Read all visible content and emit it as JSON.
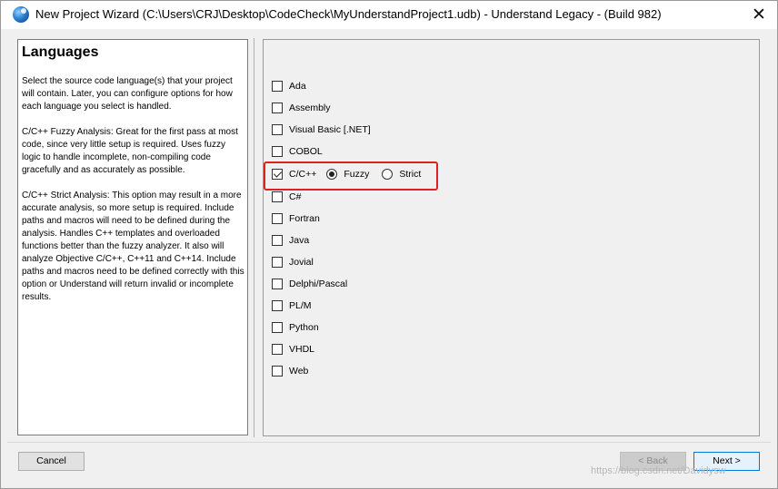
{
  "window": {
    "title": "New Project Wizard (C:\\Users\\CRJ\\Desktop\\CodeCheck\\MyUnderstandProject1.udb) - Understand Legacy - (Build 982)",
    "close_glyph": "✕"
  },
  "left": {
    "heading": "Languages",
    "paragraphs": [
      "Select the source code language(s) that your project will contain. Later, you can configure options for how each language you select is handled.",
      "C/C++ Fuzzy Analysis: Great for the first pass at most code, since very little setup is required. Uses fuzzy logic to handle incomplete, non-compiling code gracefully and as accurately as possible.",
      "C/C++ Strict Analysis: This option may result in a more accurate analysis, so more setup is required. Include paths and macros will need to be defined during the analysis. Handles C++ templates and overloaded functions better than the fuzzy analyzer. It also will analyze Objective C/C++, C++11 and C++14. Include paths and macros need to be defined correctly with this option or Understand will return invalid or incomplete results."
    ]
  },
  "languages": [
    {
      "label": "Ada",
      "checked": false
    },
    {
      "label": "Assembly",
      "checked": false
    },
    {
      "label": "Visual Basic [.NET]",
      "checked": false
    },
    {
      "label": "COBOL",
      "checked": false
    },
    {
      "label": "C/C++",
      "checked": true
    },
    {
      "label": "C#",
      "checked": false
    },
    {
      "label": "Fortran",
      "checked": false
    },
    {
      "label": "Java",
      "checked": false
    },
    {
      "label": "Jovial",
      "checked": false
    },
    {
      "label": "Delphi/Pascal",
      "checked": false
    },
    {
      "label": "PL/M",
      "checked": false
    },
    {
      "label": "Python",
      "checked": false
    },
    {
      "label": "VHDL",
      "checked": false
    },
    {
      "label": "Web",
      "checked": false
    }
  ],
  "cpp_mode": {
    "fuzzy_label": "Fuzzy",
    "strict_label": "Strict",
    "selected": "Fuzzy"
  },
  "buttons": {
    "cancel": "Cancel",
    "back": "< Back",
    "next": "Next >"
  },
  "watermark": "https://blog.csdn.net/Davidysw"
}
